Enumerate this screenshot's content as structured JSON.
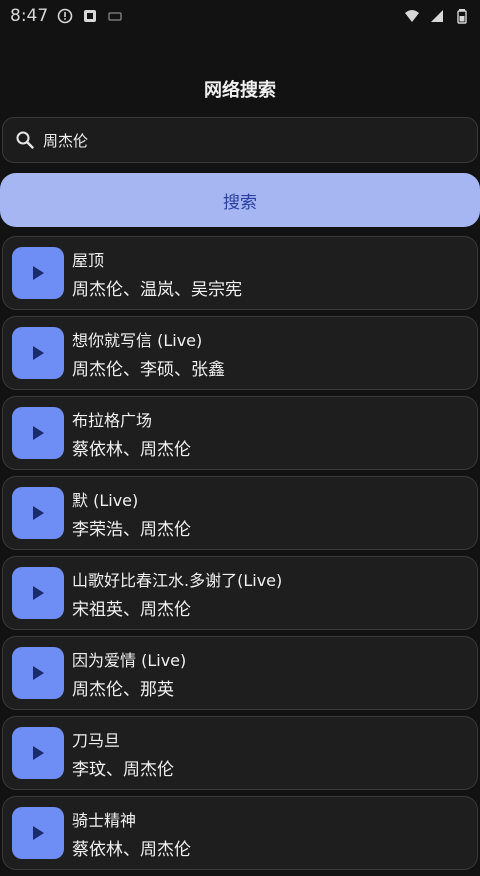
{
  "status_bar": {
    "time": "8:47",
    "icons": [
      "alert-circle-icon",
      "notification-icon",
      "sim-icon",
      "wifi-icon",
      "signal-icon",
      "battery-icon"
    ]
  },
  "page_title": "网络搜索",
  "search": {
    "query": "周杰伦",
    "icon": "search-icon",
    "button_label": "搜索"
  },
  "results": [
    {
      "title": "屋顶",
      "artists": "周杰伦、温岚、吴宗宪"
    },
    {
      "title": "想你就写信 (Live)",
      "artists": "周杰伦、李硕、张鑫"
    },
    {
      "title": "布拉格广场",
      "artists": "蔡依林、周杰伦"
    },
    {
      "title": "默 (Live)",
      "artists": "李荣浩、周杰伦"
    },
    {
      "title": "山歌好比春江水.多谢了(Live)",
      "artists": "宋祖英、周杰伦"
    },
    {
      "title": "因为爱情 (Live)",
      "artists": "周杰伦、那英"
    },
    {
      "title": "刀马旦",
      "artists": "李玟、周杰伦"
    },
    {
      "title": "骑士精神",
      "artists": "蔡依林、周杰伦"
    }
  ],
  "colors": {
    "background": "#121212",
    "card": "#1e1e1e",
    "accent": "#6e8ef5",
    "button": "#a5b6f2",
    "button_text": "#2a3f9e"
  }
}
